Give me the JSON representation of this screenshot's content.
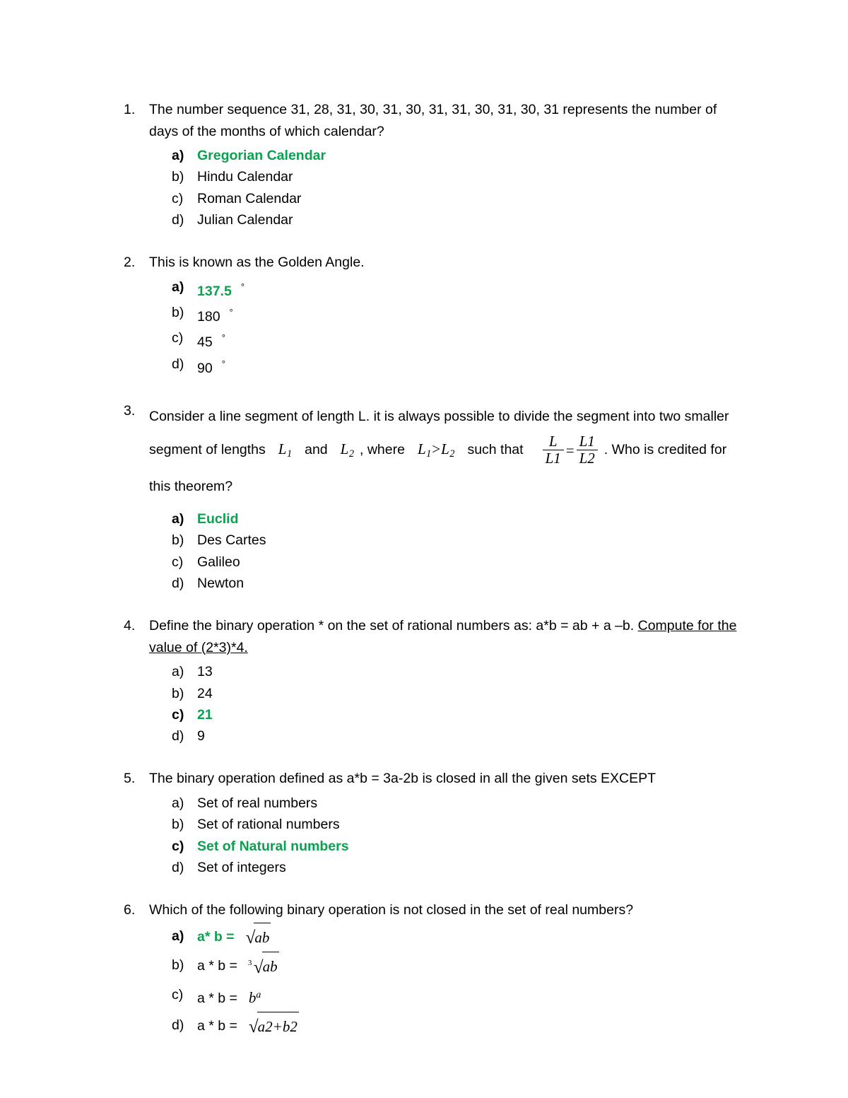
{
  "document": {
    "type": "multiple-choice-quiz",
    "answer_color": "#0aa14f"
  },
  "questions": [
    {
      "number": "1.",
      "text": "The number sequence 31, 28, 31, 30, 31, 30, 31, 31, 30, 31, 30, 31 represents the number of days of the months of which calendar?",
      "options": [
        {
          "letter": "a)",
          "text": "Gregorian Calendar",
          "correct": true
        },
        {
          "letter": "b)",
          "text": "Hindu Calendar",
          "correct": false
        },
        {
          "letter": "c)",
          "text": "Roman Calendar",
          "correct": false
        },
        {
          "letter": "d)",
          "text": "Julian Calendar",
          "correct": false
        }
      ]
    },
    {
      "number": "2.",
      "text": "This is known as the Golden Angle.",
      "options": [
        {
          "letter": "a)",
          "text": "137.5",
          "unit": "°",
          "correct": true
        },
        {
          "letter": "b)",
          "text": "180",
          "unit": "°",
          "correct": false
        },
        {
          "letter": "c)",
          "text": "45",
          "unit": "°",
          "correct": false
        },
        {
          "letter": "d)",
          "text": "90",
          "unit": "°",
          "correct": false
        }
      ]
    },
    {
      "number": "3.",
      "text_part1": "Consider a line segment of length L. it is always possible to divide the segment into two smaller segment of lengths",
      "text_part2": "and",
      "text_part3": ", where",
      "text_part4": "such that",
      "text_part5": ". Who is credited for this theorem?",
      "math": {
        "L1": "L",
        "L1_sub": "1",
        "L2": "L",
        "L2_sub": "2",
        "inequality_left": "L",
        "inequality_left_sub": "1",
        "inequality_op": ">",
        "inequality_right": "L",
        "inequality_right_sub": "2",
        "frac_left_num": "L",
        "frac_left_den": "L",
        "frac_left_den_sub": "1",
        "equals": "=",
        "frac_right_num": "L",
        "frac_right_num_sub": "1",
        "frac_right_den": "L",
        "frac_right_den_sub": "2"
      },
      "options": [
        {
          "letter": "a)",
          "text": "Euclid",
          "correct": true
        },
        {
          "letter": "b)",
          "text": "Des Cartes",
          "correct": false
        },
        {
          "letter": "c)",
          "text": "Galileo",
          "correct": false
        },
        {
          "letter": "d)",
          "text": "Newton",
          "correct": false
        }
      ]
    },
    {
      "number": "4.",
      "text_plain": "Define the binary operation * on the set of rational numbers as: a*b = ab + a –b. ",
      "text_underlined": "Compute for the value of (2*3)*4.",
      "options": [
        {
          "letter": "a)",
          "text": "13",
          "correct": false
        },
        {
          "letter": "b)",
          "text": "24",
          "correct": false
        },
        {
          "letter": "c)",
          "text": "21",
          "correct": true
        },
        {
          "letter": "d)",
          "text": "9",
          "correct": false
        }
      ]
    },
    {
      "number": "5.",
      "text": "The binary operation defined as a*b = 3a-2b is closed in all the given sets EXCEPT",
      "options": [
        {
          "letter": "a)",
          "text": "Set of real numbers",
          "correct": false
        },
        {
          "letter": "b)",
          "text": "Set of rational numbers",
          "correct": false
        },
        {
          "letter": "c)",
          "text": "Set of Natural numbers",
          "correct": true
        },
        {
          "letter": "d)",
          "text": "Set of integers",
          "correct": false
        }
      ]
    },
    {
      "number": "6.",
      "text": "Which of the following binary operation is not closed in the set of real numbers?",
      "options": [
        {
          "letter": "a)",
          "lhs": "a* b  =",
          "correct": true,
          "expr": {
            "kind": "sqrt",
            "radicand": "ab"
          }
        },
        {
          "letter": "b)",
          "lhs": "a * b =",
          "correct": false,
          "expr": {
            "kind": "root",
            "index": "3",
            "radicand": "ab"
          }
        },
        {
          "letter": "c)",
          "lhs": "a * b =",
          "correct": false,
          "expr": {
            "kind": "power",
            "base": "b",
            "exponent": "a"
          }
        },
        {
          "letter": "d)",
          "lhs": "a * b =",
          "correct": false,
          "expr": {
            "kind": "sqrt_sum",
            "base1": "a",
            "exp1": "2",
            "plus": "+",
            "base2": "b",
            "exp2": "2"
          }
        }
      ]
    }
  ]
}
